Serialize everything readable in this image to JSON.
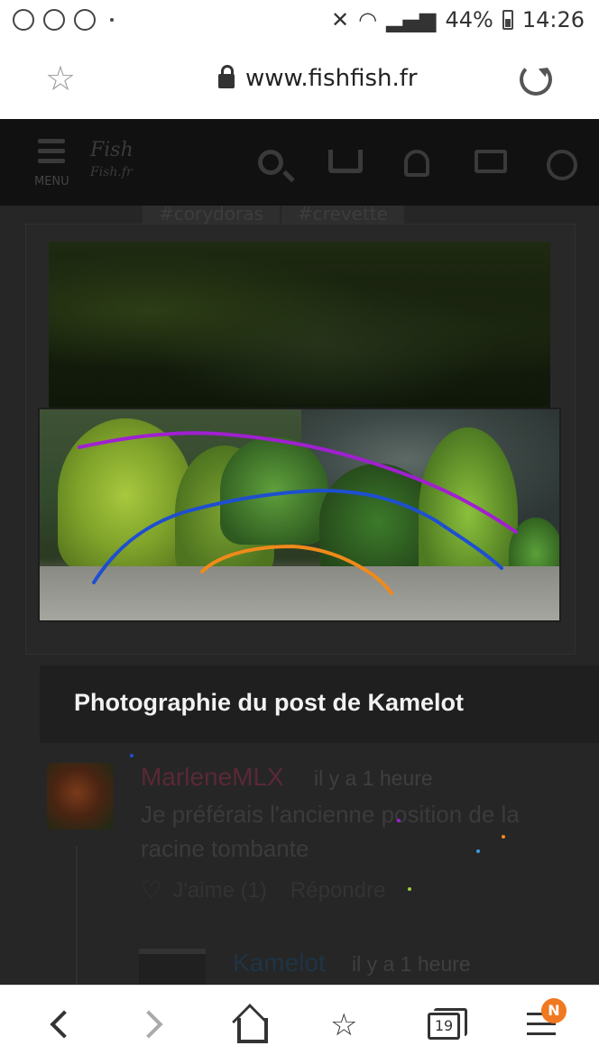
{
  "status_bar": {
    "battery": "44%",
    "time": "14:26"
  },
  "browser": {
    "url": "www.fishfish.fr"
  },
  "site_header": {
    "menu_label": "MENU",
    "logo_line1": "Fish",
    "logo_line2": "Fish.fr"
  },
  "tags": [
    "#corydoras",
    "#crevette"
  ],
  "post": {
    "caption": "Photographie du post de Kamelot",
    "overlay_line_colors": [
      "#a020d0",
      "#1e4fd0",
      "#f08a1a"
    ]
  },
  "comment": {
    "author": "MarleneMLX",
    "time": "il y a 1 heure",
    "text": "Je préférais l'ancienne position de la racine tombante",
    "like_label": "J'aime (1)",
    "reply_label": "Répondre"
  },
  "reply": {
    "author": "Kamelot",
    "time": "il y a 1 heure"
  },
  "bottom_nav": {
    "tabs_count": "19",
    "badge": "N"
  }
}
